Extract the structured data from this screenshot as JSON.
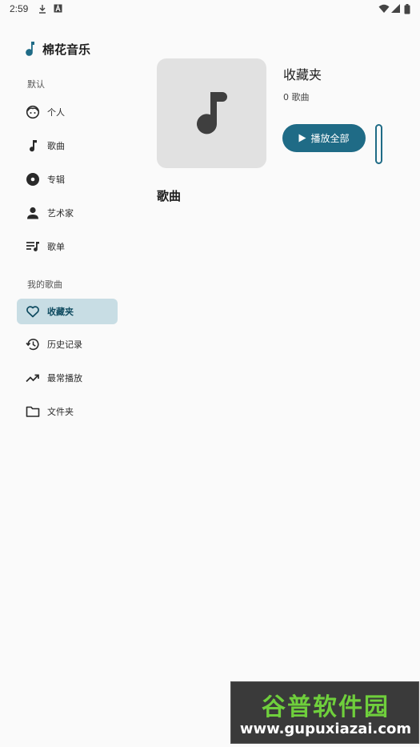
{
  "status_bar": {
    "time": "2:59"
  },
  "app": {
    "title": "棉花音乐",
    "accent": "#1f6b86"
  },
  "sidebar": {
    "section_default": "默认",
    "default_items": [
      {
        "label": "个人",
        "icon": "face-icon"
      },
      {
        "label": "歌曲",
        "icon": "music-note-icon"
      },
      {
        "label": "专辑",
        "icon": "album-disc-icon"
      },
      {
        "label": "艺术家",
        "icon": "person-icon"
      },
      {
        "label": "歌单",
        "icon": "playlist-icon"
      }
    ],
    "section_mine": "我的歌曲",
    "mine_items": [
      {
        "label": "收藏夹",
        "icon": "heart-icon",
        "active": true
      },
      {
        "label": "历史记录",
        "icon": "history-icon"
      },
      {
        "label": "最常播放",
        "icon": "trending-up-icon"
      },
      {
        "label": "文件夹",
        "icon": "folder-icon"
      }
    ]
  },
  "main": {
    "playlist_title": "收藏夹",
    "song_count": "0 歌曲",
    "play_all_label": "播放全部",
    "songs_heading": "歌曲"
  },
  "watermark": {
    "top": "谷普软件园",
    "bottom": "www.gupuxiazai.com"
  }
}
